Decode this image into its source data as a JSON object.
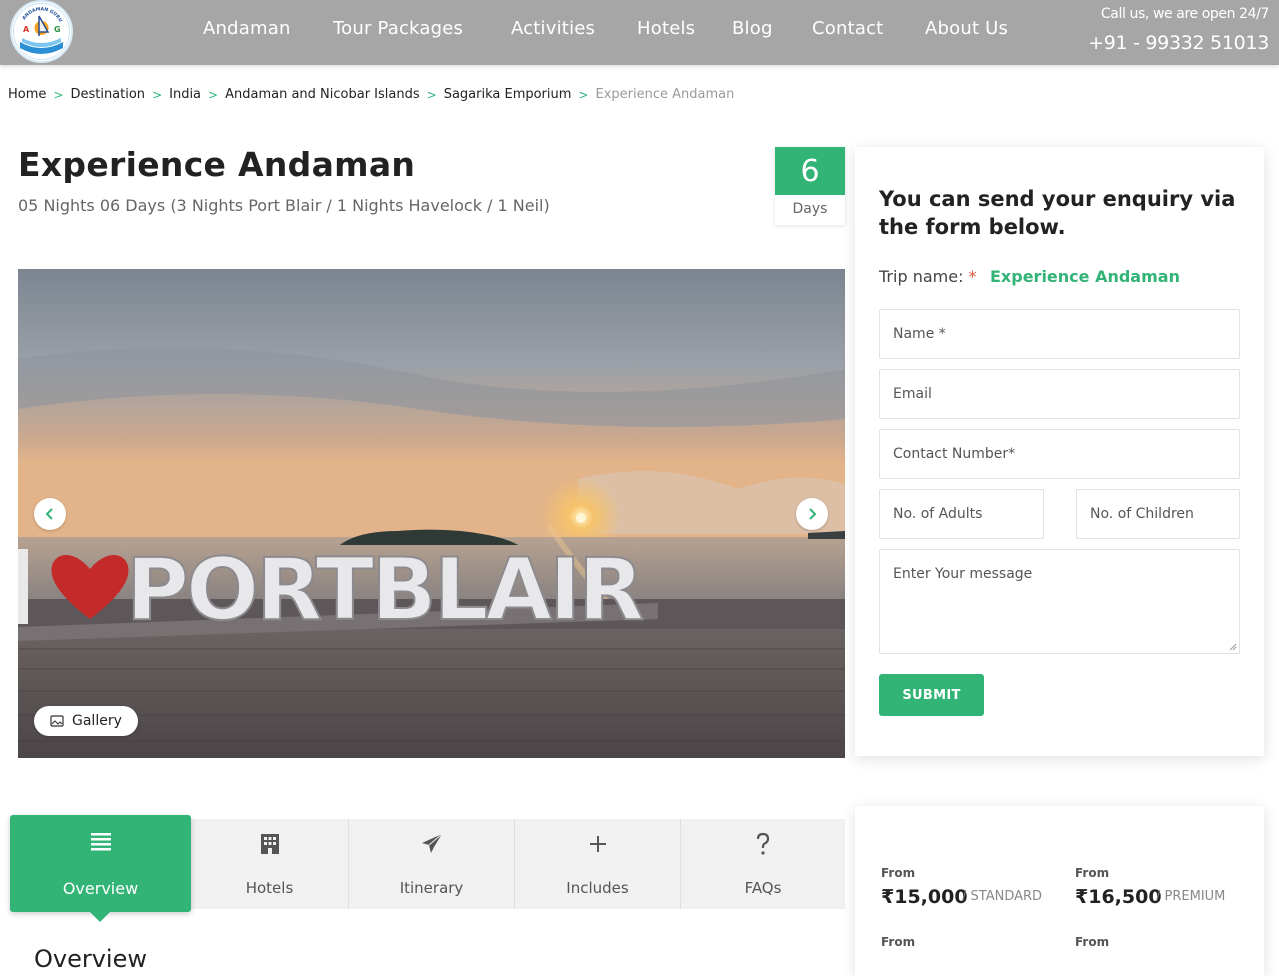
{
  "header": {
    "logo_text": "ANDAMAN GURU",
    "nav": [
      {
        "label": "Andaman"
      },
      {
        "label": "Tour Packages"
      },
      {
        "label": "Activities"
      },
      {
        "label": "Hotels"
      },
      {
        "label": "Blog"
      },
      {
        "label": "Contact"
      },
      {
        "label": "About Us"
      }
    ],
    "call_text": "Call us, we are open 24/7",
    "phone": "+91 - 99332 51013"
  },
  "breadcrumb": {
    "items": [
      "Home",
      "Destination",
      "India",
      "Andaman and Nicobar Islands",
      "Sagarika Emporium"
    ],
    "current": "Experience Andaman"
  },
  "trip": {
    "title": "Experience Andaman",
    "subtitle": "05 Nights 06 Days (3 Nights Port Blair / 1 Nights Havelock / 1 Neil)",
    "days_number": "6",
    "days_label": "Days"
  },
  "hero": {
    "sign_text": "PORTBLAIR",
    "gallery_label": "Gallery"
  },
  "enquiry": {
    "heading": "You can send your enquiry via the form below.",
    "trip_label": "Trip name:",
    "trip_required": "*",
    "trip_value": "Experience Andaman",
    "name_placeholder": "Name *",
    "email_placeholder": "Email",
    "contact_placeholder": "Contact Number*",
    "adults_placeholder": "No. of Adults",
    "children_placeholder": "No. of Children",
    "message_placeholder": "Enter Your message",
    "submit_label": "SUBMIT"
  },
  "tabs": [
    {
      "label": "Overview",
      "icon": "list-icon",
      "active": true
    },
    {
      "label": "Hotels",
      "icon": "building-icon"
    },
    {
      "label": "Itinerary",
      "icon": "paper-plane-icon"
    },
    {
      "label": "Includes",
      "icon": "plus-icon"
    },
    {
      "label": "FAQs",
      "icon": "question-icon"
    }
  ],
  "overview_heading": "Overview",
  "pricing": {
    "rows": [
      {
        "from": "From",
        "price": "₹15,000",
        "type": "/ STANDARD"
      },
      {
        "from": "From",
        "price": "₹16,500",
        "type": "/ PREMIUM"
      },
      {
        "from": "From"
      },
      {
        "from": "From"
      }
    ]
  },
  "colors": {
    "accent": "#32b476",
    "header_bg": "#a6a6a6",
    "required": "#e8553e"
  }
}
